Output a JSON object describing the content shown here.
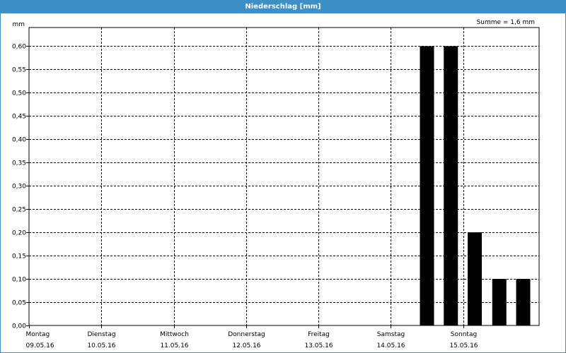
{
  "window": {
    "title": "Niederschlag [mm]"
  },
  "chart_data": {
    "type": "bar",
    "title": "Niederschlag [mm]",
    "ylabel": "mm",
    "sum_label": "Summe = 1,6 mm",
    "ylim": [
      0,
      0.64
    ],
    "yticks": [
      "0,00",
      "0,05",
      "0,10",
      "0,15",
      "0,20",
      "0,25",
      "0,30",
      "0,35",
      "0,40",
      "0,45",
      "0,50",
      "0,55",
      "0,60"
    ],
    "xlim": [
      0,
      7.05
    ],
    "days": [
      {
        "weekday": "Montag",
        "date": "09.05.16"
      },
      {
        "weekday": "Dienstag",
        "date": "10.05.16"
      },
      {
        "weekday": "Mittwoch",
        "date": "11.05.16"
      },
      {
        "weekday": "Donnerstag",
        "date": "12.05.16"
      },
      {
        "weekday": "Freitag",
        "date": "13.05.16"
      },
      {
        "weekday": "Samstag",
        "date": "14.05.16"
      },
      {
        "weekday": "Sonntag",
        "date": "15.05.16"
      }
    ],
    "bars": [
      {
        "x": 5.5,
        "value": 0.6
      },
      {
        "x": 5.83,
        "value": 0.6
      },
      {
        "x": 6.16,
        "value": 0.2
      },
      {
        "x": 6.5,
        "value": 0.1
      },
      {
        "x": 6.83,
        "value": 0.1
      }
    ],
    "grid": true,
    "colors": {
      "title_bar": "#3d8fc6",
      "bar": "#000000",
      "grid": "#000000"
    }
  }
}
